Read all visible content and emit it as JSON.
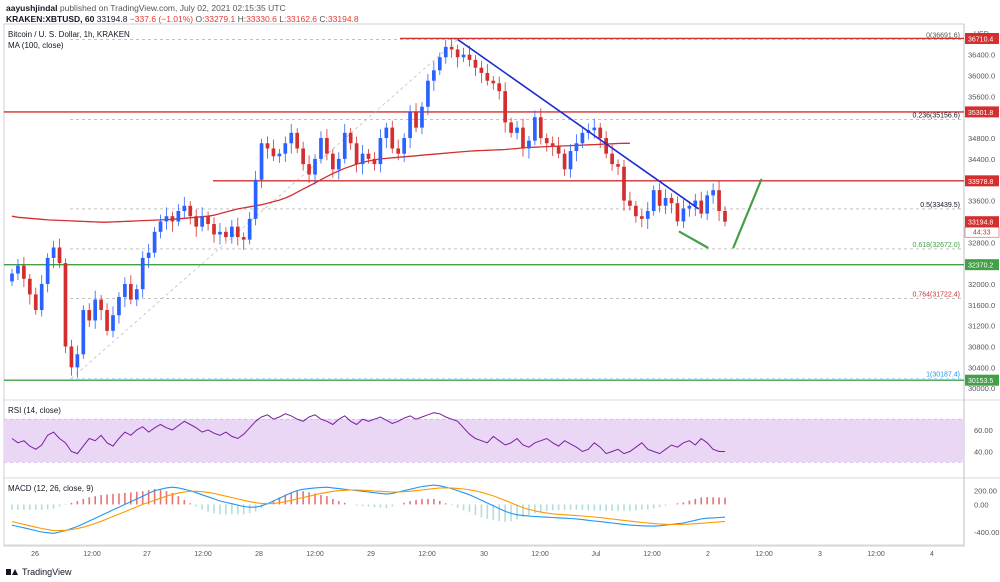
{
  "header": {
    "author": "aayushjindal",
    "published_text": "published on TradingView.com, July 02, 2021 02:15:35 UTC",
    "symbol": "KRAKEN:XBTUSD, 60",
    "price": "33194.8",
    "change": "−337.6 (−1.01%)",
    "o_label": "O:",
    "o_value": "33279.1",
    "h_label": "H:",
    "h_value": "33330.6",
    "l_label": "L:",
    "l_value": "33162.6",
    "c_label": "C:",
    "c_value": "33194.8"
  },
  "footer": {
    "brand": "TradingView"
  },
  "colors": {
    "up": "#2962ff",
    "down": "#d32f2f",
    "ma": "#d32f2f",
    "trendline": "#1e2bd1",
    "support_green": "#43a047",
    "resistance_red": "#d32f2f",
    "rsi": "#7b1fa2",
    "rsi_band": "#ead7f5",
    "macd": "#2196f3",
    "signal": "#ff9800",
    "hist_pos": "#e57373",
    "hist_neg": "#b2dfdb"
  },
  "chart_data": {
    "type": "line",
    "title": "Bitcoin / U. S. Dollar, 1h, KRAKEN",
    "indicator_label": "MA (100, close)",
    "currency_label": "USD",
    "ylim": [
      29850,
      36950
    ],
    "y_ticks": [
      "36400.0",
      "36000.0",
      "35600.0",
      "34800.0",
      "34400.0",
      "33600.0",
      "32800.0",
      "32000.0",
      "31600.0",
      "31200.0",
      "30800.0",
      "30400.0",
      "30000.0"
    ],
    "x_ticks": [
      "26",
      "12:00",
      "27",
      "12:00",
      "28",
      "12:00",
      "29",
      "12:00",
      "30",
      "12:00",
      "Jul",
      "12:00",
      "2",
      "12:00",
      "3",
      "12:00",
      "4"
    ],
    "price_close": [
      32200,
      32350,
      32100,
      31800,
      31500,
      32000,
      32500,
      32700,
      32400,
      30800,
      30400,
      30650,
      31500,
      31300,
      31700,
      31500,
      31100,
      31400,
      31750,
      32000,
      31700,
      31900,
      32500,
      32600,
      33000,
      33200,
      33300,
      33200,
      33400,
      33500,
      33300,
      33100,
      33300,
      33150,
      32950,
      33000,
      32900,
      33100,
      32900,
      32850,
      33250,
      34000,
      34700,
      34600,
      34450,
      34500,
      34700,
      34900,
      34600,
      34300,
      34100,
      34400,
      34800,
      34500,
      34200,
      34400,
      34900,
      34700,
      34300,
      34500,
      34400,
      34300,
      34800,
      35000,
      34600,
      34500,
      34800,
      35300,
      35000,
      35400,
      35900,
      36100,
      36350,
      36550,
      36500,
      36350,
      36400,
      36300,
      36150,
      36050,
      35900,
      35850,
      35700,
      35100,
      34900,
      35000,
      34600,
      34750,
      35200,
      34800,
      34700,
      34650,
      34500,
      34200,
      34550,
      34700,
      34900,
      34950,
      35000,
      34800,
      34500,
      34300,
      34250,
      33600,
      33500,
      33300,
      33250,
      33400,
      33800,
      33500,
      33650,
      33550,
      33200,
      33450,
      33500,
      33600,
      33350,
      33700,
      33800,
      33400,
      33195
    ],
    "ma100": [
      33300,
      33280,
      33270,
      33260,
      33250,
      33240,
      33230,
      33225,
      33220,
      33215,
      33210,
      33205,
      33200,
      33195,
      33190,
      33185,
      33185,
      33190,
      33195,
      33200,
      33205,
      33210,
      33215,
      33220,
      33225,
      33230,
      33235,
      33240,
      33250,
      33260,
      33270,
      33280,
      33290,
      33300,
      33320,
      33350,
      33380,
      33410,
      33440,
      33460,
      33480,
      33500,
      33520,
      33550,
      33580,
      33610,
      33650,
      33700,
      33760,
      33820,
      33880,
      33940,
      34000,
      34060,
      34120,
      34170,
      34220,
      34260,
      34300,
      34330,
      34360,
      34380,
      34400,
      34410,
      34420,
      34430,
      34440,
      34450,
      34460,
      34470,
      34480,
      34490,
      34500,
      34510,
      34520,
      34530,
      34540,
      34550,
      34555,
      34560,
      34565,
      34570,
      34575,
      34580,
      34590,
      34600,
      34610,
      34620,
      34625,
      34630,
      34635,
      34640,
      34645,
      34650,
      34655,
      34660,
      34665,
      34670,
      34675,
      34680,
      34685,
      34690,
      34695,
      34700,
      34700
    ],
    "levels": [
      {
        "label": "0(36691.6)",
        "value": 36691.6
      },
      {
        "label": "0.236(35156.6)",
        "value": 35156.6
      },
      {
        "label": "0.5(33439.5)",
        "value": 33439.5
      },
      {
        "label": "0.618(32672.0)",
        "value": 32672.0
      },
      {
        "label": "0.764(31722.4)",
        "value": 31722.4
      },
      {
        "label": "1(30187.4)",
        "value": 30187.4
      }
    ],
    "price_tags": [
      {
        "label": "36710.4",
        "value": 36710.4,
        "kind": "red"
      },
      {
        "label": "35301.8",
        "value": 35301.8,
        "kind": "red"
      },
      {
        "label": "33978.8",
        "value": 33978.8,
        "kind": "red"
      },
      {
        "label": "33194.8",
        "value": 33194.8,
        "kind": "red",
        "sub": "44:33"
      },
      {
        "label": "32370.2",
        "value": 32370.2,
        "kind": "green"
      },
      {
        "label": "30153.5",
        "value": 30153.5,
        "kind": "green"
      }
    ],
    "rsi": {
      "label": "RSI (14, close)",
      "ticks": [
        "60.00",
        "40.00"
      ],
      "ylim": [
        20,
        85
      ],
      "band": [
        30,
        70
      ],
      "values": [
        52,
        48,
        50,
        45,
        42,
        46,
        55,
        58,
        52,
        48,
        40,
        38,
        45,
        52,
        50,
        55,
        48,
        45,
        52,
        58,
        55,
        60,
        63,
        58,
        62,
        65,
        62,
        60,
        64,
        68,
        65,
        62,
        58,
        60,
        57,
        55,
        58,
        54,
        52,
        56,
        62,
        68,
        72,
        74,
        70,
        72,
        75,
        73,
        70,
        68,
        72,
        74,
        70,
        68,
        65,
        70,
        73,
        68,
        65,
        70,
        68,
        70,
        72,
        69,
        66,
        68,
        71,
        73,
        70,
        72,
        74,
        76,
        75,
        72,
        70,
        68,
        62,
        56,
        52,
        50,
        48,
        54,
        50,
        46,
        48,
        52,
        46,
        44,
        48,
        50,
        52,
        48,
        45,
        50,
        47,
        44,
        40,
        42,
        48,
        44,
        38,
        40,
        42,
        38,
        40,
        44,
        48,
        42,
        40,
        38,
        42,
        46,
        44,
        48,
        50,
        46,
        52,
        48,
        42,
        40,
        40
      ]
    },
    "macd": {
      "label": "MACD (12, 26, close, 9)",
      "ticks": [
        "200.00",
        "0.00",
        "-400.00"
      ],
      "ylim": [
        -560,
        340
      ],
      "macd_line": [
        -300,
        -320,
        -340,
        -360,
        -380,
        -400,
        -410,
        -420,
        -400,
        -380,
        -350,
        -320,
        -280,
        -240,
        -200,
        -160,
        -120,
        -80,
        -40,
        0,
        40,
        80,
        120,
        160,
        200,
        220,
        240,
        250,
        240,
        220,
        200,
        170,
        140,
        110,
        80,
        50,
        30,
        10,
        -10,
        -30,
        -40,
        -40,
        -20,
        10,
        50,
        90,
        130,
        170,
        200,
        220,
        230,
        240,
        245,
        250,
        240,
        230,
        220,
        210,
        200,
        190,
        180,
        170,
        160,
        150,
        160,
        180,
        200,
        220,
        240,
        260,
        270,
        280,
        270,
        250,
        230,
        200,
        170,
        140,
        100,
        60,
        20,
        -20,
        -60,
        -100,
        -130,
        -150,
        -160,
        -170,
        -175,
        -180,
        -185,
        -190,
        -195,
        -200,
        -205,
        -210,
        -220,
        -230,
        -240,
        -250,
        -260,
        -270,
        -280,
        -290,
        -300,
        -305,
        -310,
        -315,
        -315,
        -310,
        -300,
        -290,
        -280,
        -270,
        -250,
        -230,
        -210,
        -200,
        -195,
        -190,
        -185
      ],
      "signal_line": [
        -250,
        -270,
        -290,
        -310,
        -330,
        -350,
        -365,
        -380,
        -380,
        -375,
        -365,
        -350,
        -330,
        -305,
        -275,
        -245,
        -210,
        -175,
        -140,
        -105,
        -70,
        -35,
        0,
        30,
        60,
        90,
        120,
        145,
        165,
        180,
        190,
        190,
        185,
        175,
        160,
        140,
        120,
        100,
        80,
        60,
        40,
        25,
        15,
        10,
        15,
        25,
        40,
        60,
        80,
        100,
        120,
        140,
        160,
        175,
        190,
        200,
        205,
        210,
        210,
        205,
        200,
        195,
        190,
        185,
        180,
        180,
        185,
        190,
        200,
        210,
        220,
        230,
        238,
        240,
        238,
        232,
        224,
        212,
        196,
        176,
        152,
        124,
        92,
        58,
        22,
        -14,
        -46,
        -72,
        -94,
        -112,
        -126,
        -136,
        -144,
        -150,
        -156,
        -162,
        -168,
        -175,
        -183,
        -192,
        -202,
        -212,
        -222,
        -232,
        -242,
        -252,
        -262,
        -270,
        -278,
        -284,
        -288,
        -290,
        -290,
        -288,
        -285,
        -280,
        -274,
        -267,
        -260,
        -253,
        -246
      ]
    },
    "annotations": [
      {
        "type": "trendline",
        "from": [
          75,
          36691.6
        ],
        "to": [
          108,
          33439.5
        ]
      },
      {
        "type": "diagonal-fib",
        "from": [
          10,
          30187.4
        ],
        "to": [
          75,
          36691.6
        ]
      },
      {
        "type": "green-stroke",
        "from": [
          109,
          33000
        ],
        "to": [
          112,
          32700
        ]
      },
      {
        "type": "green-stroke",
        "from": [
          113,
          32700
        ],
        "to": [
          116,
          34000
        ]
      }
    ]
  }
}
